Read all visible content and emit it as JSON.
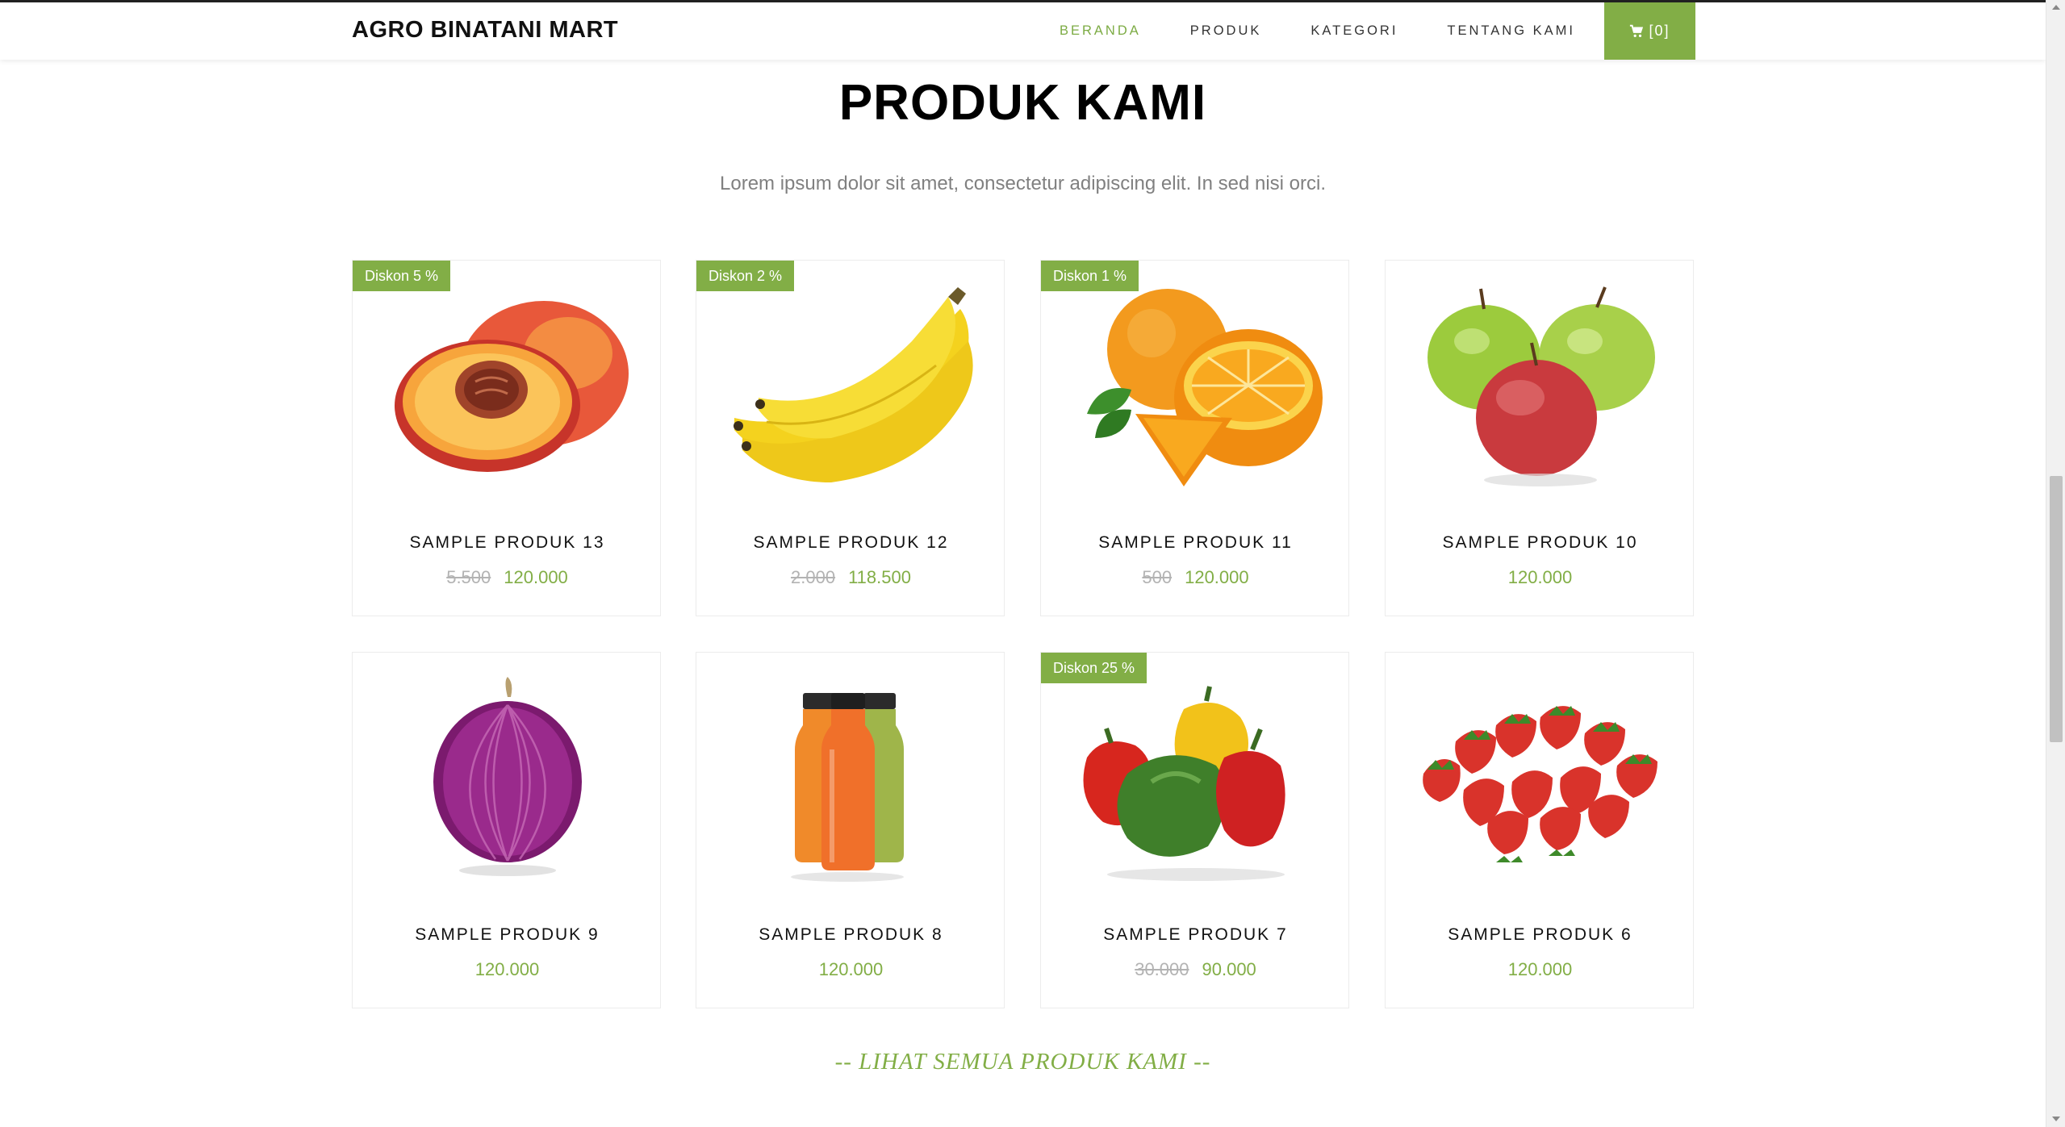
{
  "navbar": {
    "brand": "AGRO BINATANI MART",
    "links": [
      "BERANDA",
      "PRODUK",
      "KATEGORI",
      "TENTANG KAMI"
    ],
    "cart_label": "[0]"
  },
  "section": {
    "title": "PRODUK KAMI",
    "subtitle": "Lorem ipsum dolor sit amet, consectetur adipiscing elit. In sed nisi orci."
  },
  "products": [
    {
      "name": "SAMPLE PRODUK 13",
      "badge": "Diskon 5 %",
      "old_price": "5.500",
      "price": "120.000",
      "image": "peach"
    },
    {
      "name": "SAMPLE PRODUK 12",
      "badge": "Diskon 2 %",
      "old_price": "2.000",
      "price": "118.500",
      "image": "banana"
    },
    {
      "name": "SAMPLE PRODUK 11",
      "badge": "Diskon 1 %",
      "old_price": "500",
      "price": "120.000",
      "image": "orange"
    },
    {
      "name": "SAMPLE PRODUK 10",
      "badge": "",
      "old_price": "",
      "price": "120.000",
      "image": "apple"
    },
    {
      "name": "SAMPLE PRODUK 9",
      "badge": "",
      "old_price": "",
      "price": "120.000",
      "image": "onion"
    },
    {
      "name": "SAMPLE PRODUK 8",
      "badge": "",
      "old_price": "",
      "price": "120.000",
      "image": "juice"
    },
    {
      "name": "SAMPLE PRODUK 7",
      "badge": "Diskon 25 %",
      "old_price": "30.000",
      "price": "90.000",
      "image": "pepper"
    },
    {
      "name": "SAMPLE PRODUK 6",
      "badge": "",
      "old_price": "",
      "price": "120.000",
      "image": "strawberry"
    }
  ],
  "see_all_label": "-- LIHAT SEMUA PRODUK KAMI --",
  "colors": {
    "accent": "#82ae46"
  }
}
